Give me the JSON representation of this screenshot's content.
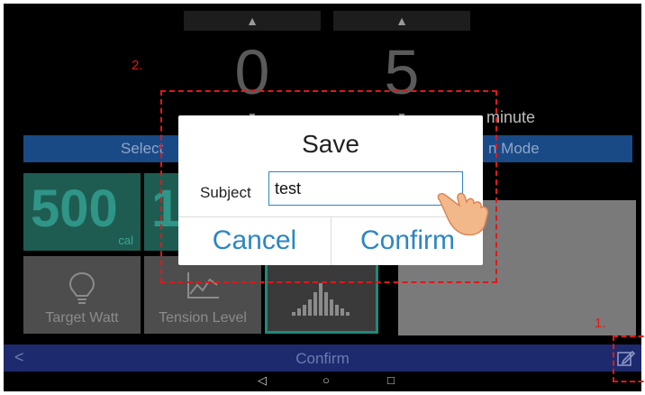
{
  "picker": {
    "hours": "0",
    "minutes": "5",
    "up_glyph": "▲",
    "down_glyph": "▼",
    "minute_label": "minute"
  },
  "mode_bar": {
    "left_text": "Select",
    "right_text": "n Mode"
  },
  "tiles": {
    "calories_value": "500",
    "calories_unit": "cal",
    "second_value": "1",
    "target_watt_label": "Target Watt",
    "tension_level_label": "Tension Level"
  },
  "dialog": {
    "title": "Save",
    "subject_label": "Subject",
    "subject_value": "test",
    "cancel_label": "Cancel",
    "confirm_label": "Confirm"
  },
  "bottom_bar": {
    "back_glyph": "<",
    "confirm_label": "Confirm"
  },
  "system_nav": {
    "back_glyph": "◁",
    "home_glyph": "○",
    "recent_glyph": "□"
  },
  "annotations": {
    "step1": "1.",
    "step2": "2."
  },
  "colors": {
    "dialog_accent": "#2b86c3",
    "annotation_red": "#e01818",
    "mode_bar": "#1a4a86",
    "tile_teal": "#1e5c52",
    "bottom_bar": "#1d2a6e"
  }
}
